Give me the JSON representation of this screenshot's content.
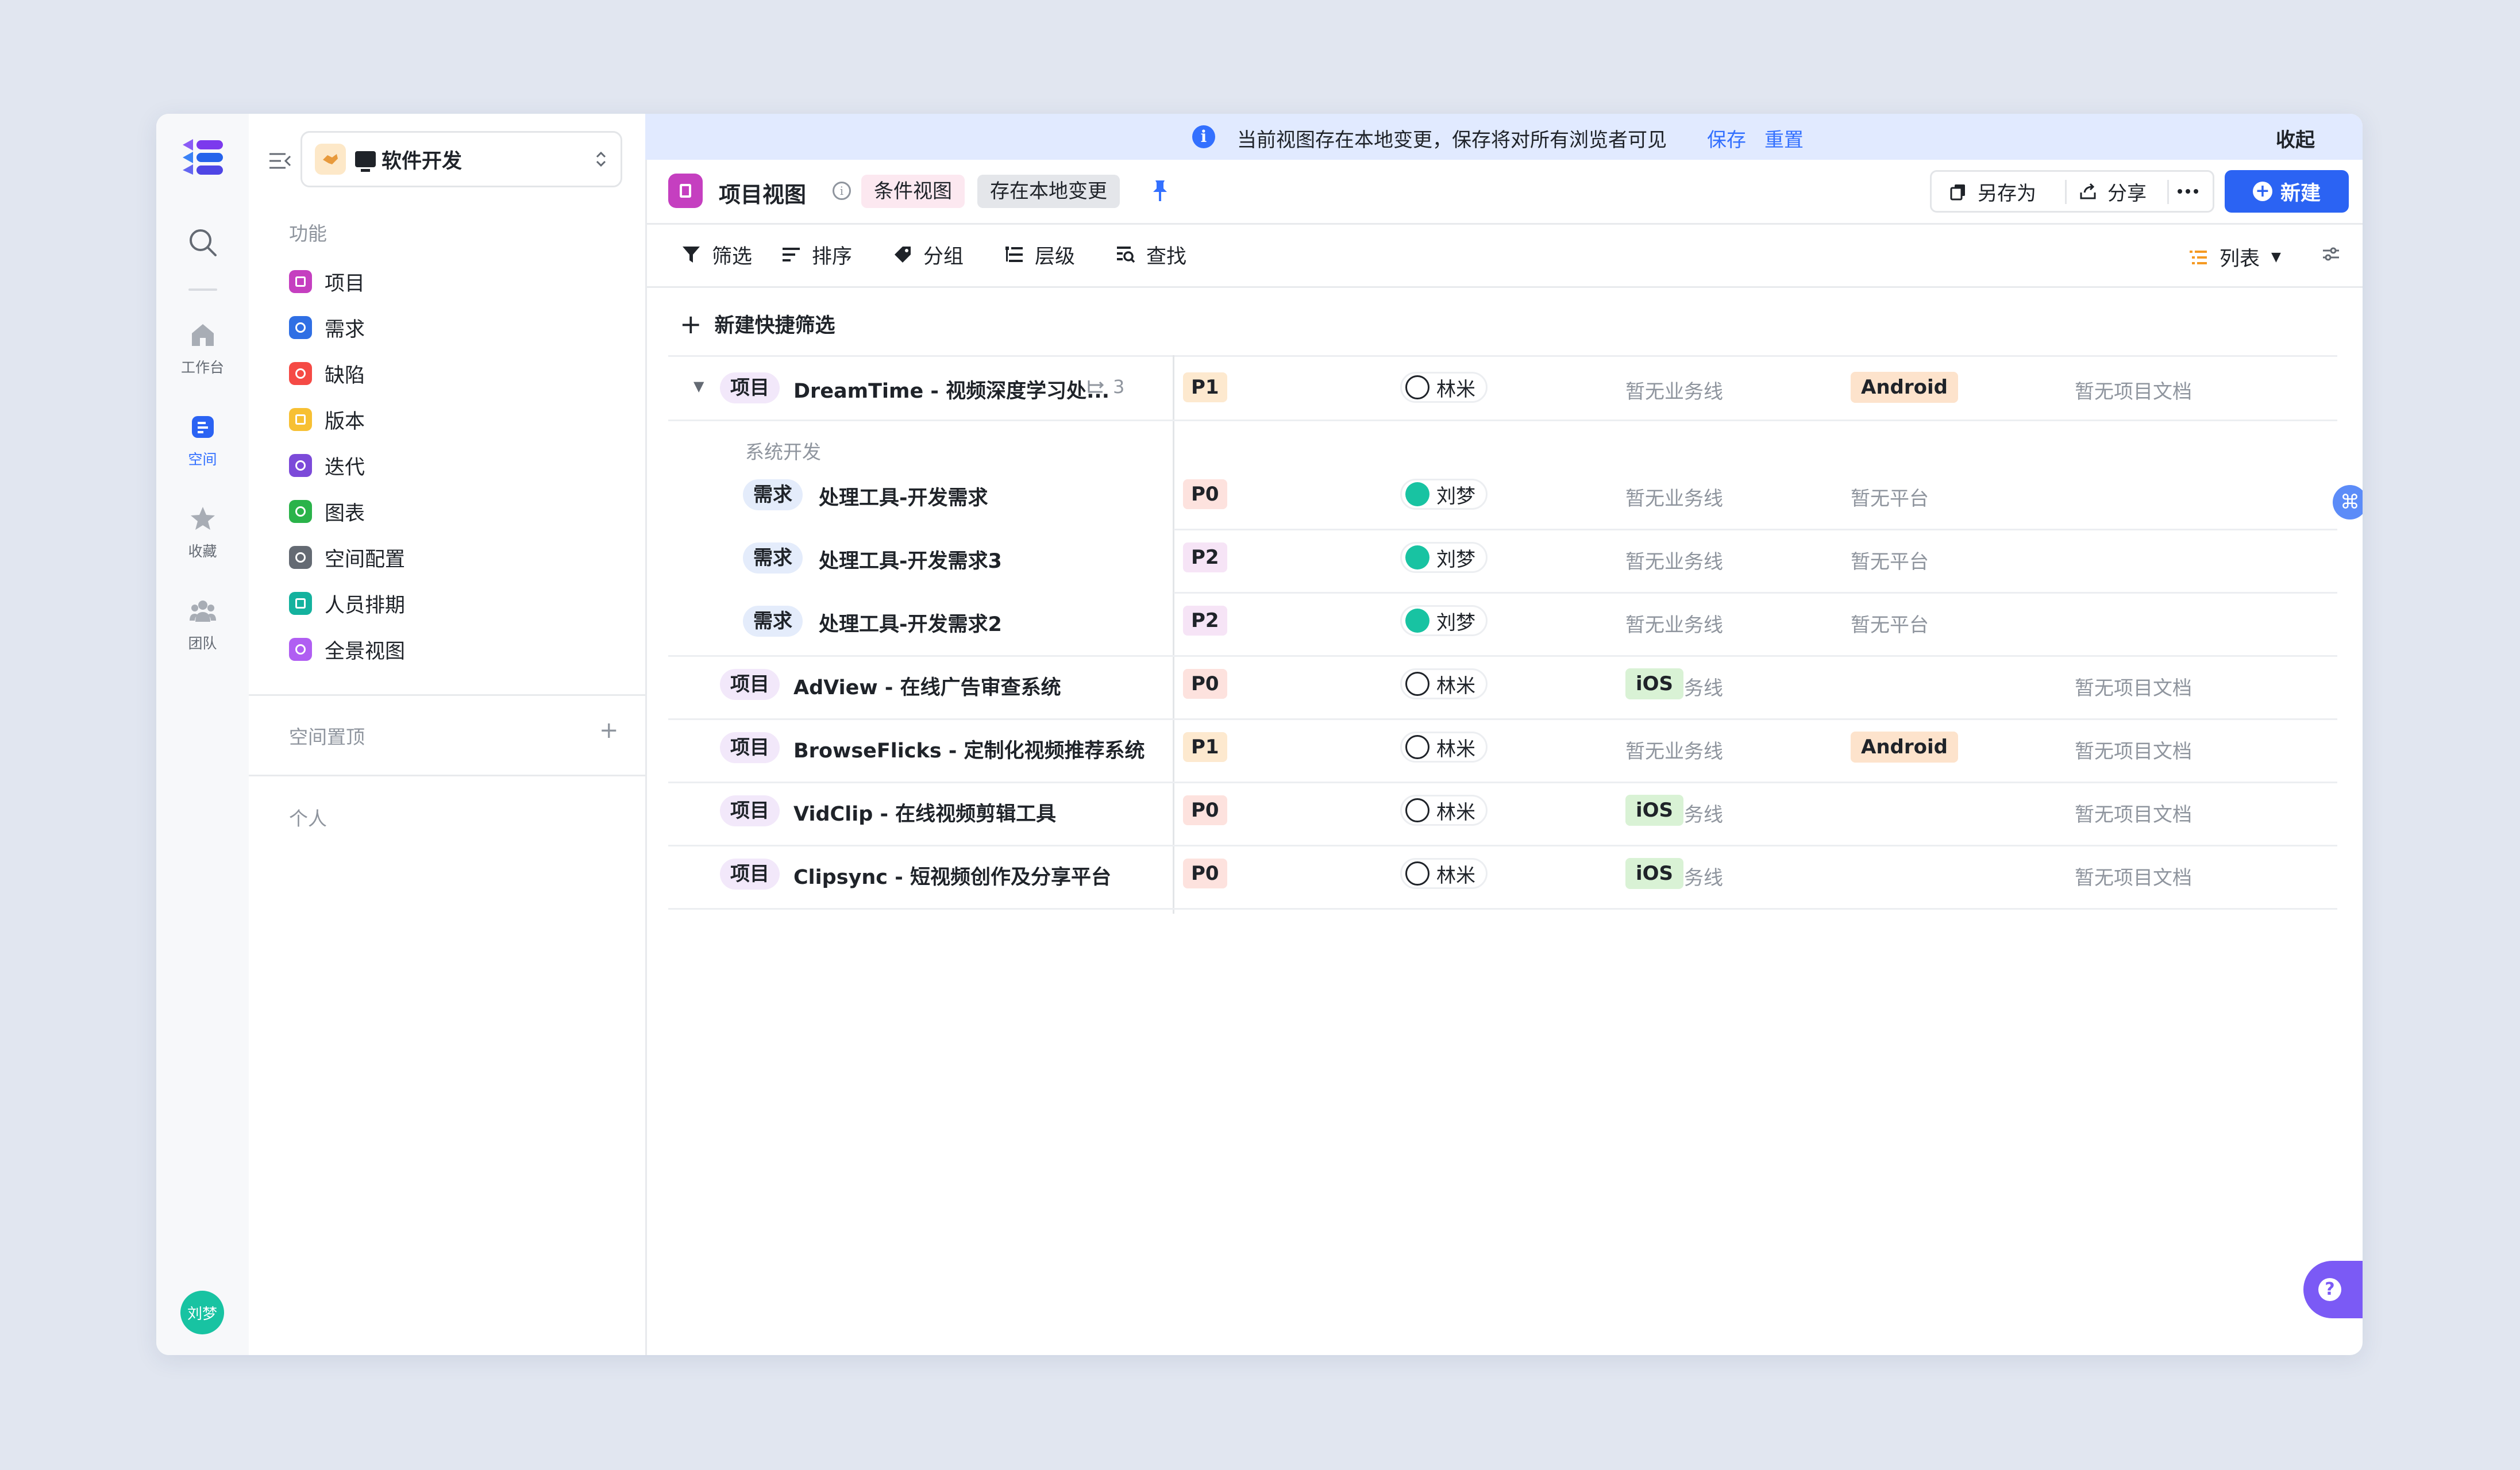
{
  "rail": {
    "items": [
      {
        "label": "工作台",
        "icon": "home-icon"
      },
      {
        "label": "空间",
        "icon": "space-icon"
      },
      {
        "label": "收藏",
        "icon": "star-icon"
      },
      {
        "label": "团队",
        "icon": "team-icon"
      }
    ],
    "avatar": "刘梦"
  },
  "sidebar": {
    "space_name": "软件开发",
    "section_features": "功能",
    "items": [
      {
        "label": "项目",
        "color": "#c53fc0"
      },
      {
        "label": "需求",
        "color": "#2f6fe4"
      },
      {
        "label": "缺陷",
        "color": "#f54a45"
      },
      {
        "label": "版本",
        "color": "#f7c033"
      },
      {
        "label": "迭代",
        "color": "#7c4ad9"
      },
      {
        "label": "图表",
        "color": "#2ab34a"
      },
      {
        "label": "空间配置",
        "color": "#646a73"
      },
      {
        "label": "人员排期",
        "color": "#14b29e"
      },
      {
        "label": "全景视图",
        "color": "#b05ef2"
      }
    ],
    "section_pinned": "空间置顶",
    "section_personal": "个人"
  },
  "banner": {
    "text": "当前视图存在本地变更，保存将对所有浏览者可见",
    "save": "保存",
    "reset": "重置",
    "collapse": "收起"
  },
  "viewbar": {
    "title": "项目视图",
    "tag_condition": "条件视图",
    "tag_local": "存在本地变更",
    "save_as": "另存为",
    "share": "分享",
    "new": "新建"
  },
  "toolbar": {
    "filter": "筛选",
    "sort": "排序",
    "group": "分组",
    "level": "层级",
    "find": "查找",
    "view_mode": "列表"
  },
  "quick_filter": "新建快捷筛选",
  "group_label": "系统开发",
  "rows": [
    {
      "type": "项目",
      "title": "DreamTime - 视频深度学习处...",
      "sub_count": "3",
      "priority": "P1",
      "owner": "林米",
      "business": "暂无业务线",
      "platform": "Android",
      "doc": "暂无项目文档"
    },
    {
      "type": "需求",
      "title": "处理工具-开发需求",
      "priority": "P0",
      "owner": "刘梦",
      "business": "暂无业务线",
      "platform": "暂无平台",
      "doc": ""
    },
    {
      "type": "需求",
      "title": "处理工具-开发需求3",
      "priority": "P2",
      "owner": "刘梦",
      "business": "暂无业务线",
      "platform": "暂无平台",
      "doc": ""
    },
    {
      "type": "需求",
      "title": "处理工具-开发需求2",
      "priority": "P2",
      "owner": "刘梦",
      "business": "暂无业务线",
      "platform": "暂无平台",
      "doc": ""
    },
    {
      "type": "项目",
      "title": "AdView - 在线广告审查系统",
      "priority": "P0",
      "owner": "林米",
      "business": "暂无业务线",
      "platform": "iOS",
      "doc": "暂无项目文档"
    },
    {
      "type": "项目",
      "title": "BrowseFlicks - 定制化视频推荐系统",
      "priority": "P1",
      "owner": "林米",
      "business": "暂无业务线",
      "platform": "Android",
      "doc": "暂无项目文档"
    },
    {
      "type": "项目",
      "title": "VidClip - 在线视频剪辑工具",
      "priority": "P0",
      "owner": "林米",
      "business": "暂无业务线",
      "platform": "iOS",
      "doc": "暂无项目文档"
    },
    {
      "type": "项目",
      "title": "Clipsync - 短视频创作及分享平台",
      "priority": "P0",
      "owner": "林米",
      "business": "暂无业务线",
      "platform": "iOS",
      "doc": "暂无项目文档"
    }
  ],
  "colors": {
    "accent": "#3370ff",
    "new_button": "#2b63f3",
    "banner_bg": "#e1eaff"
  }
}
